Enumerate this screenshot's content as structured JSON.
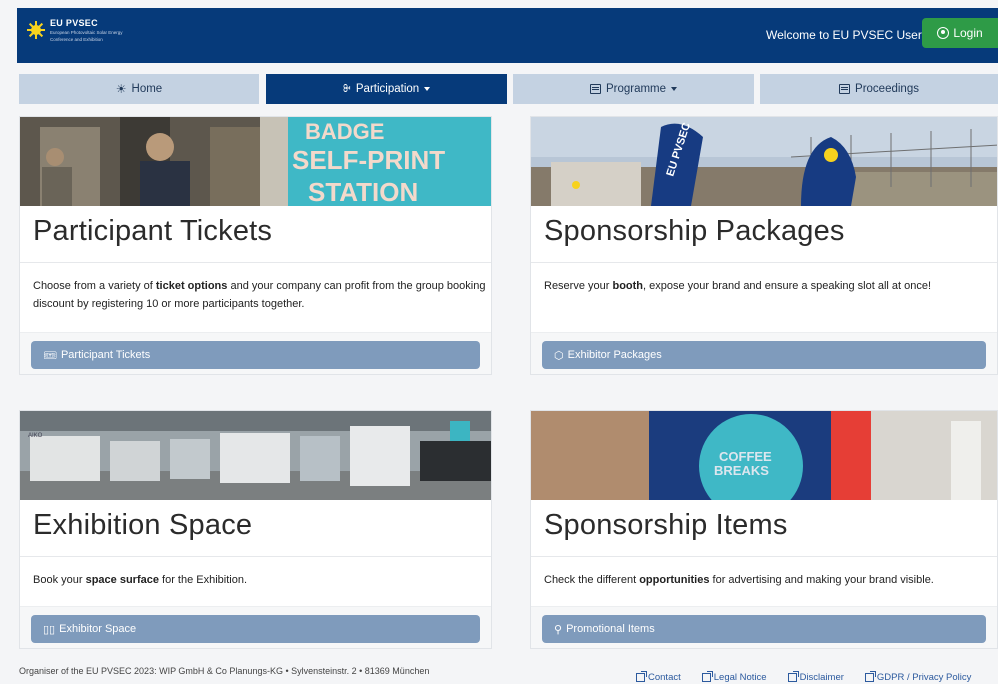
{
  "header": {
    "logo_title": "EU PVSEC",
    "logo_subtitle_1": "European Photovoltaic Solar Energy",
    "logo_subtitle_2": "Conference and Exhibition",
    "welcome": "Welcome to EU PVSEC User Area",
    "login_label": "Login"
  },
  "nav": {
    "items": [
      {
        "label": "Home",
        "icon": "sun-icon"
      },
      {
        "label": "Participation",
        "icon": "people-icon",
        "active": true
      },
      {
        "label": "Programme",
        "icon": "calendar-icon"
      },
      {
        "label": "Proceedings",
        "icon": "document-icon"
      }
    ]
  },
  "cards": [
    {
      "photo_text": "BADGE SELF-PRINT STATION",
      "title": "Participant Tickets",
      "text_before": "Choose from a variety of ",
      "text_bold": "ticket options",
      "text_after": " and your company can profit from the group booking discount by registering 10 or more participants together.",
      "button": "Participant Tickets",
      "button_icon": "ticket-icon"
    },
    {
      "photo_text": "EU PVSEC",
      "title": "Sponsorship Packages",
      "text_before": "Reserve your ",
      "text_bold": "booth",
      "text_after": ", expose your brand and ensure a speaking slot all at once!",
      "button": "Exhibitor Packages",
      "button_icon": "cube-icon"
    },
    {
      "photo_text": "AIKO",
      "title": "Exhibition Space",
      "text_before": "Book your ",
      "text_bold": "space surface",
      "text_after": " for the Exhibition.",
      "button": "Exhibitor Space",
      "button_icon": "layout-icon"
    },
    {
      "photo_text": "COFFEE BREAKS",
      "title": "Sponsorship Items",
      "text_before": "Check the different ",
      "text_bold": "opportunities",
      "text_after": " for advertising and making your brand visible.",
      "button": "Promotional Items",
      "button_icon": "lightbulb-icon"
    }
  ],
  "footer": {
    "organiser": "Organiser of the EU PVSEC 2023: WIP GmbH & Co Planungs-KG • Sylvensteinstr. 2 • 81369 München",
    "links": [
      "Contact",
      "Legal Notice",
      "Disclaimer",
      "GDPR / Privacy Policy"
    ]
  }
}
